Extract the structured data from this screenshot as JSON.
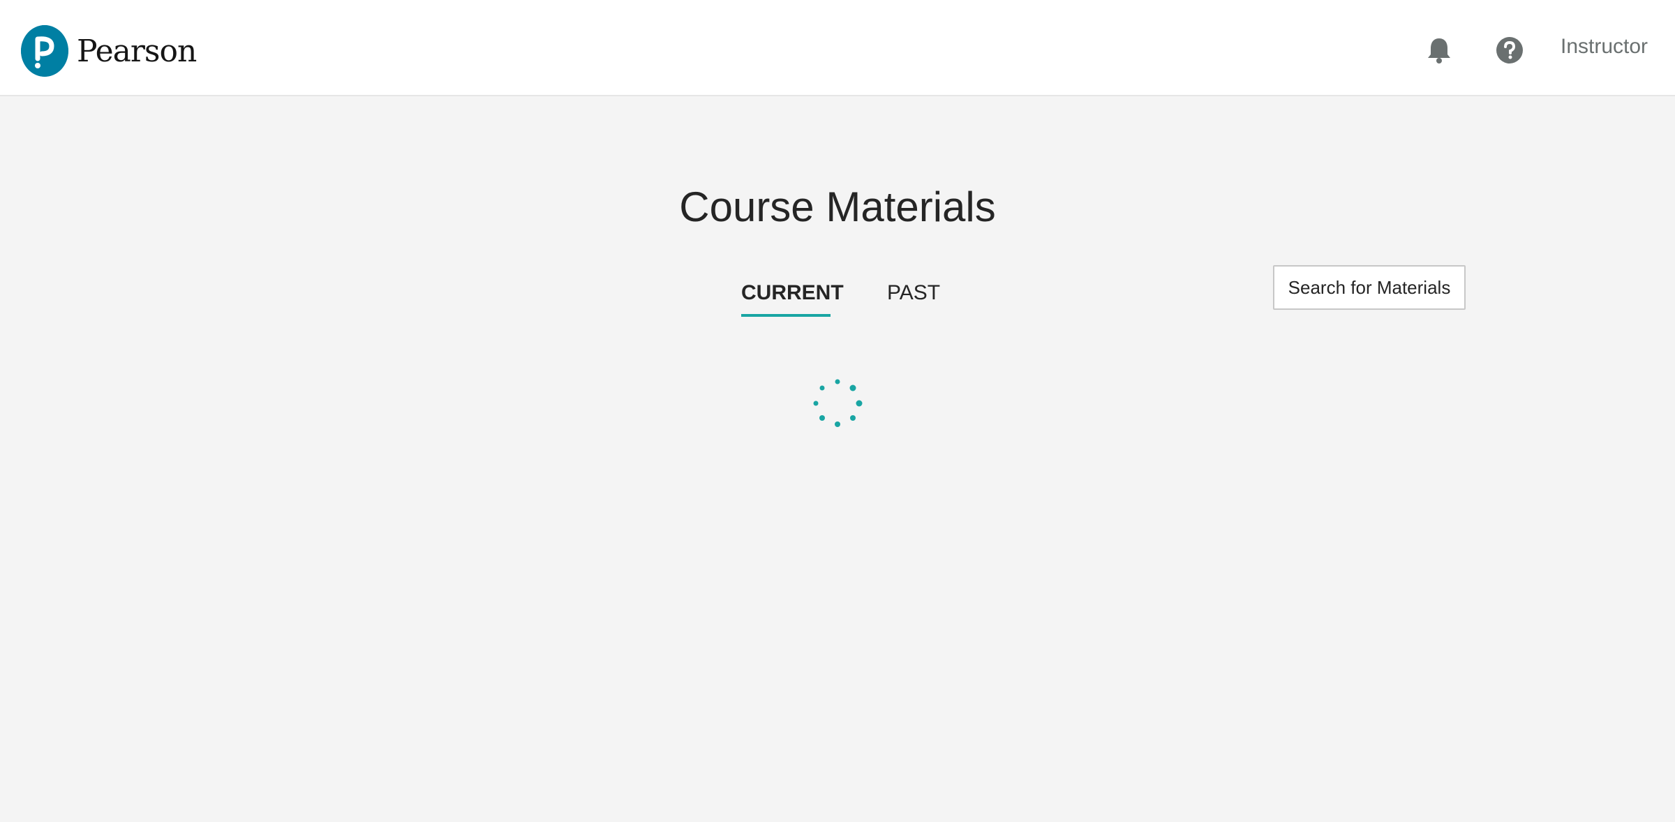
{
  "header": {
    "logo_text": "Pearson",
    "user_label": "Instructor",
    "icons": {
      "notifications": "bell-icon",
      "help": "help-icon"
    }
  },
  "main": {
    "title": "Course Materials",
    "tabs": [
      {
        "label": "CURRENT",
        "selected": true
      },
      {
        "label": "PAST",
        "selected": false
      }
    ],
    "search_button_label": "Search for Materials",
    "loading": true
  },
  "colors": {
    "brand_blue": "#007fa3",
    "accent_teal": "#19a5a3",
    "background": "#f4f4f4",
    "icon_gray": "#6a7070"
  }
}
